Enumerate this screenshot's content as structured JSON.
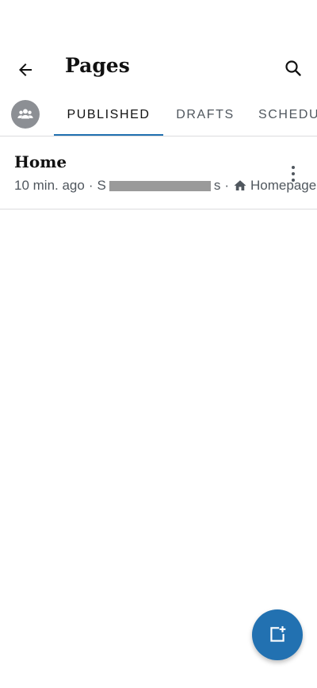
{
  "header": {
    "title": "Pages",
    "back_icon": "arrow-left-icon",
    "search_icon": "search-icon"
  },
  "tabs": {
    "site_icon": "people-icon",
    "items": [
      {
        "label": "PUBLISHED",
        "active": true
      },
      {
        "label": "DRAFTS",
        "active": false
      },
      {
        "label": "SCHEDULED",
        "active": false
      }
    ]
  },
  "pages": [
    {
      "title": "Home",
      "time": "10 min. ago",
      "separator": "·",
      "status_partial_start": "S",
      "status_partial_end": "s",
      "homepage_label": "Homepage",
      "home_icon": "home-icon",
      "more_icon": "more-vertical-icon"
    }
  ],
  "fab": {
    "icon": "add-page-icon"
  },
  "colors": {
    "accent": "#2271b1",
    "muted": "#50575e",
    "avatar_bg": "#8c8f94"
  }
}
